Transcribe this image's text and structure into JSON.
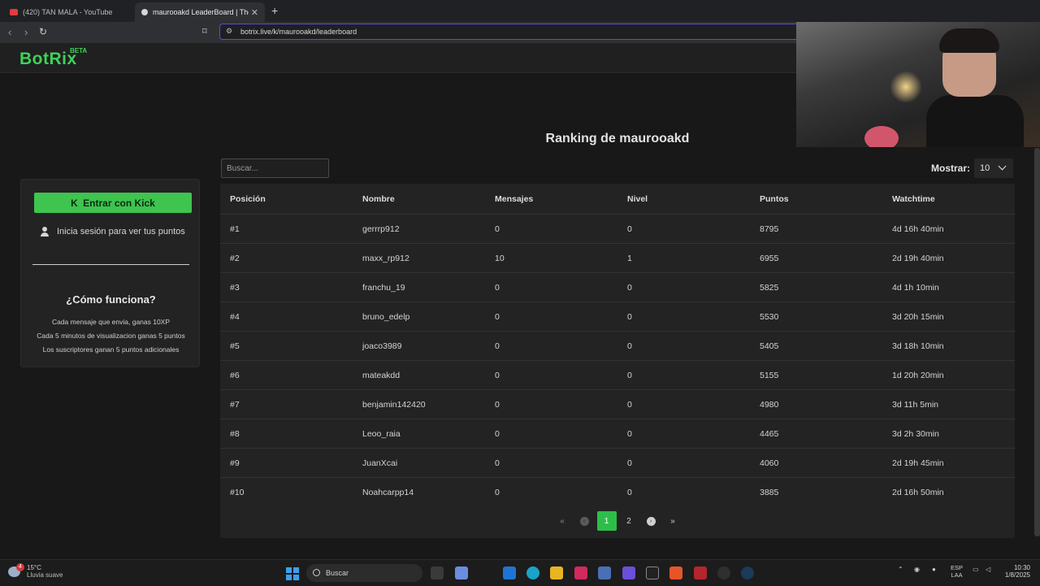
{
  "browser": {
    "tabs": [
      {
        "title": "(420) TAN MALA - YouTube",
        "fav_color": "#e23b3b"
      },
      {
        "title": "maurooakd LeaderBoard | The b",
        "fav_color": "#d6d6d6"
      }
    ],
    "url": "botrix.live/k/maurooakd/leaderboard"
  },
  "site": {
    "logo": "BotRix",
    "beta": "BETA"
  },
  "sidebar": {
    "kick_button": "Entrar con Kick",
    "login_text": "Inicia sesión para ver tus puntos",
    "how_title": "¿Cómo funciona?",
    "how_lines": [
      "Cada mensaje que envia, ganas 10XP",
      "Cada 5 minutos de visualizacion ganas 5 puntos",
      "Los suscriptores ganan 5 puntos adicionales"
    ]
  },
  "main": {
    "title": "Ranking de maurooakd",
    "search_placeholder": "Buscar...",
    "show_label": "Mostrar:",
    "show_value": "10",
    "columns": [
      "Posición",
      "Nombre",
      "Mensajes",
      "Nivel",
      "Puntos",
      "Watchtime"
    ],
    "rows": [
      [
        "#1",
        "gerrrp912",
        "0",
        "0",
        "8795",
        "4d 16h 40min"
      ],
      [
        "#2",
        "maxx_rp912",
        "10",
        "1",
        "6955",
        "2d 19h 40min"
      ],
      [
        "#3",
        "franchu_19",
        "0",
        "0",
        "5825",
        "4d 1h 10min"
      ],
      [
        "#4",
        "bruno_edelp",
        "0",
        "0",
        "5530",
        "3d 20h 15min"
      ],
      [
        "#5",
        "joaco3989",
        "0",
        "0",
        "5405",
        "3d 18h 10min"
      ],
      [
        "#6",
        "mateakdd",
        "0",
        "0",
        "5155",
        "1d 20h 20min"
      ],
      [
        "#7",
        "benjamin142420",
        "0",
        "0",
        "4980",
        "3d 11h 5min"
      ],
      [
        "#8",
        "Leoo_raia",
        "0",
        "0",
        "4465",
        "3d 2h 30min"
      ],
      [
        "#9",
        "JuanXcai",
        "0",
        "0",
        "4060",
        "2d 19h 45min"
      ],
      [
        "#10",
        "Noahcarpp14",
        "0",
        "0",
        "3885",
        "2d 16h 50min"
      ]
    ],
    "pagination": {
      "first": "«",
      "prev": "‹",
      "pages": [
        "1",
        "2"
      ],
      "current": "1",
      "next": "›",
      "last": "»"
    }
  },
  "taskbar": {
    "weather_temp": "15°C",
    "weather_desc": "Lluvia suave",
    "weather_badge": "4",
    "search_label": "Buscar",
    "lang_top": "ESP",
    "lang_bottom": "LAA",
    "time": "10:30",
    "date": "1/8/2025"
  },
  "colors": {
    "accent": "#3ec44f",
    "background": "#181818",
    "panel": "#232323"
  }
}
